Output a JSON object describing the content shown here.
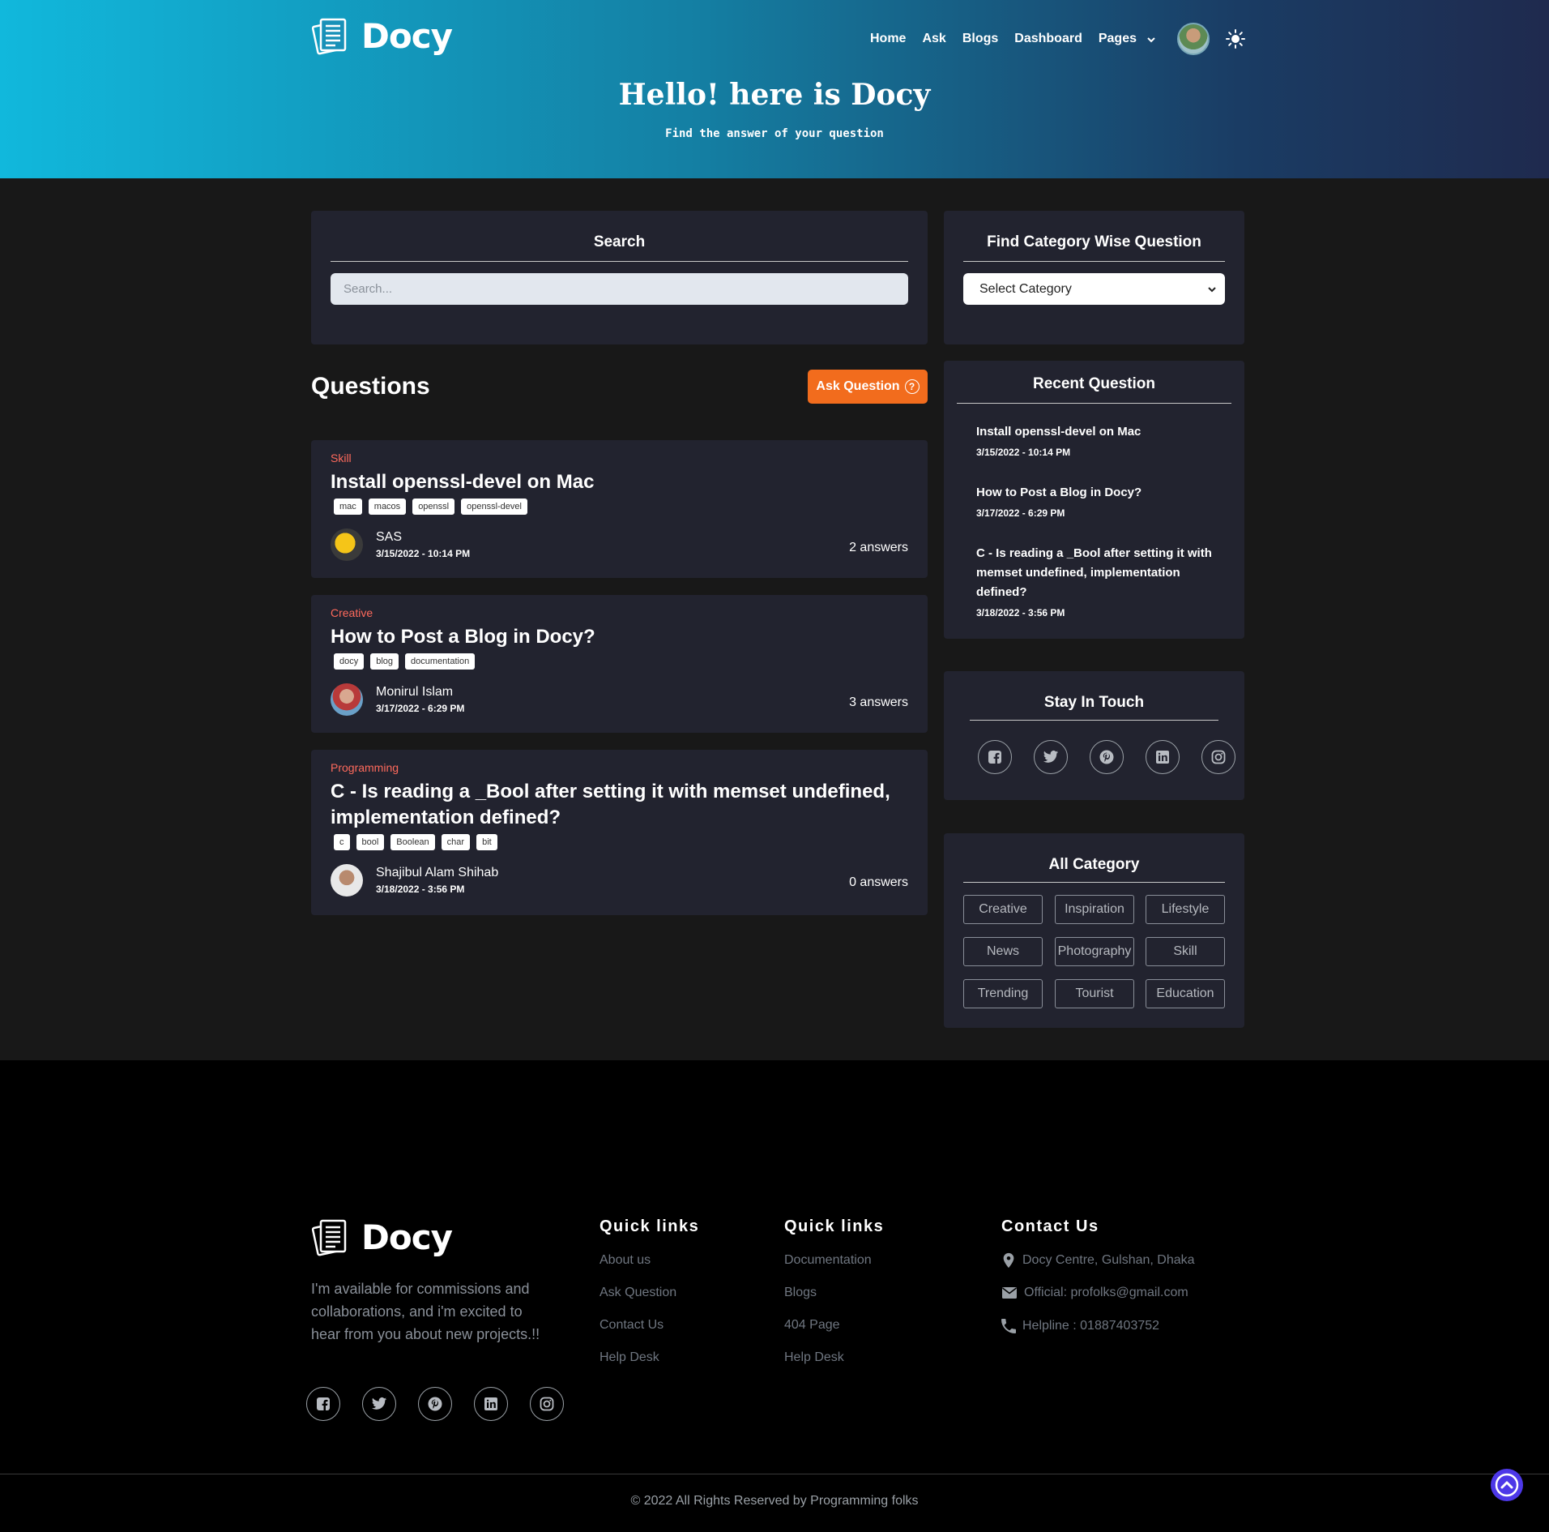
{
  "header": {
    "logo_text": "Docy",
    "nav": [
      "Home",
      "Ask",
      "Blogs",
      "Dashboard",
      "Pages"
    ],
    "hero_title": "Hello! here is Docy",
    "hero_subtitle": "Find the answer of your question"
  },
  "search": {
    "title": "Search",
    "placeholder": "Search..."
  },
  "category_filter": {
    "title": "Find Category Wise Question",
    "selected": "Select Category"
  },
  "questions": {
    "heading": "Questions",
    "ask_button": "Ask Question",
    "items": [
      {
        "category": "Skill",
        "title": "Install openssl-devel on Mac",
        "tags": [
          "mac",
          "macos",
          "openssl",
          "openssl-devel"
        ],
        "author": "SAS",
        "date": "3/15/2022 - 10:14 PM",
        "answers": "2 answers"
      },
      {
        "category": "Creative",
        "title": "How to Post a Blog in Docy?",
        "tags": [
          "docy",
          "blog",
          "documentation"
        ],
        "author": "Monirul Islam",
        "date": "3/17/2022 - 6:29 PM",
        "answers": "3 answers"
      },
      {
        "category": "Programming",
        "title": "C - Is reading a _Bool after setting it with memset undefined, implementation defined?",
        "tags": [
          "c",
          "bool",
          "Boolean",
          "char",
          "bit"
        ],
        "author": "Shajibul Alam Shihab",
        "date": "3/18/2022 - 3:56 PM",
        "answers": "0 answers"
      }
    ]
  },
  "recent": {
    "title": "Recent Question",
    "items": [
      {
        "title": "Install openssl-devel on Mac",
        "date": "3/15/2022 - 10:14 PM"
      },
      {
        "title": "How to Post a Blog in Docy?",
        "date": "3/17/2022 - 6:29 PM"
      },
      {
        "title": "C - Is reading a _Bool after setting it with memset undefined, implementation defined?",
        "date": "3/18/2022 - 3:56 PM"
      }
    ]
  },
  "stay_in_touch": {
    "title": "Stay In Touch",
    "icons": [
      "facebook-icon",
      "twitter-icon",
      "pinterest-icon",
      "linkedin-icon",
      "instagram-icon"
    ]
  },
  "all_category": {
    "title": "All Category",
    "items": [
      "Creative",
      "Inspiration",
      "Lifestyle",
      "News",
      "Photography",
      "Skill",
      "Trending",
      "Tourist",
      "Education"
    ]
  },
  "footer": {
    "logo_text": "Docy",
    "about": "I'm available for commissions and collaborations, and i'm excited to hear from you about new projects.!!",
    "quick_links_1": {
      "title": "Quick links",
      "links": [
        "About us",
        "Ask Question",
        "Contact Us",
        "Help Desk"
      ]
    },
    "quick_links_2": {
      "title": "Quick links",
      "links": [
        "Documentation",
        "Blogs",
        "404 Page",
        "Help Desk"
      ]
    },
    "contact": {
      "title": "Contact Us",
      "address": "Docy Centre, Gulshan, Dhaka",
      "email": "Official: profolks@gmail.com",
      "phone": "Helpline : 01887403752"
    },
    "copyright": "© 2022 All Rights Reserved by Programming folks"
  },
  "colors": {
    "accent": "#f26c1d",
    "category_text": "#ff6a5c",
    "card_bg": "#22232f",
    "page_bg": "#181818",
    "scroll_top": "#4d38e8"
  }
}
